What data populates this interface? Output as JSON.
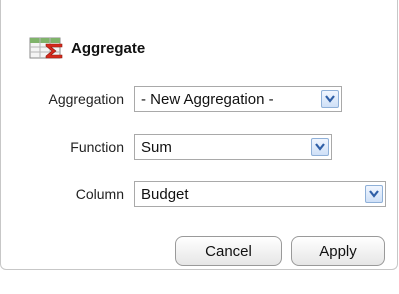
{
  "dialog": {
    "title": "Aggregate",
    "icon": "spreadsheet-sigma-icon"
  },
  "fields": {
    "aggregation": {
      "label": "Aggregation",
      "value": "- New Aggregation -"
    },
    "function": {
      "label": "Function",
      "value": "Sum"
    },
    "column": {
      "label": "Column",
      "value": "Budget"
    }
  },
  "buttons": {
    "cancel": "Cancel",
    "apply": "Apply"
  },
  "colors": {
    "sigma": "#d62a1c",
    "sheet_green": "#7fb36a",
    "arrow_blue": "#2f5fa7"
  }
}
